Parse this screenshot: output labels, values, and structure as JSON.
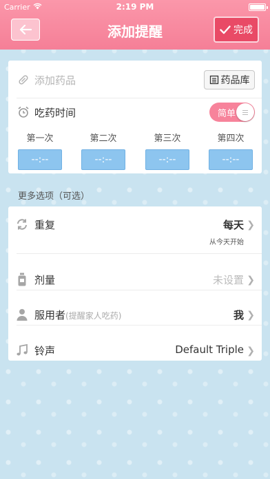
{
  "status_bar": {
    "carrier": "Carrier",
    "time": "2:19 PM"
  },
  "header": {
    "title": "添加提醒",
    "done_label": "完成"
  },
  "medicine": {
    "placeholder": "添加药品",
    "library_label": "药品库"
  },
  "schedule": {
    "label": "吃药时间",
    "mode_label": "简单",
    "doses": [
      {
        "label": "第一次",
        "time": "--:--"
      },
      {
        "label": "第二次",
        "time": "--:--"
      },
      {
        "label": "第三次",
        "time": "--:--"
      },
      {
        "label": "第四次",
        "time": "--:--"
      }
    ]
  },
  "options": {
    "section_title": "更多选项（可选）",
    "repeat": {
      "label": "重复",
      "value": "每天",
      "sub": "从今天开始"
    },
    "dosage": {
      "label": "剂量",
      "value": "未设置"
    },
    "user": {
      "label": "服用者",
      "hint": "(提醒家人吃药)",
      "value": "我"
    },
    "ringtone": {
      "label": "铃声",
      "value": "Default Triple"
    }
  },
  "colors": {
    "header": "#f57f97",
    "accent": "#e94a66",
    "time_box": "#8dc5ef",
    "background": "#c9e3f0"
  }
}
